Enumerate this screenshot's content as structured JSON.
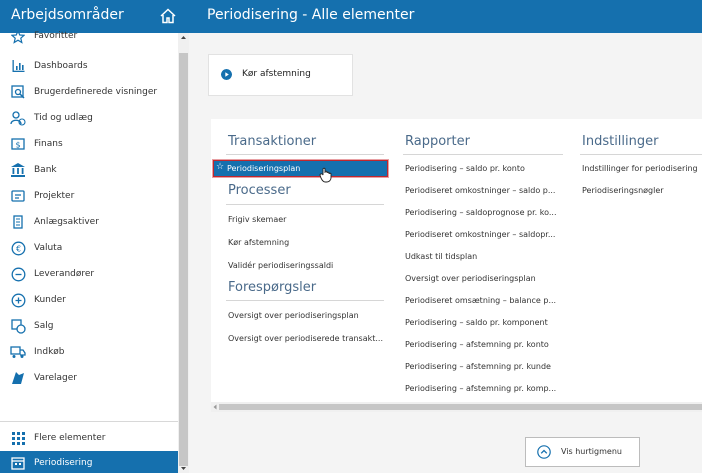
{
  "header": {
    "nav_title": "Arbejdsområder",
    "page_title": "Periodisering - Alle elementer",
    "home_icon": "home-icon"
  },
  "sidebar": {
    "items": [
      {
        "label": "Favoritter",
        "icon": "star-icon"
      },
      {
        "label": "Dashboards",
        "icon": "bar-chart-icon"
      },
      {
        "label": "Brugerdefinerede visninger",
        "icon": "custom-view-icon"
      },
      {
        "label": "Tid og udlæg",
        "icon": "time-expense-icon"
      },
      {
        "label": "Finans",
        "icon": "finance-icon"
      },
      {
        "label": "Bank",
        "icon": "bank-icon"
      },
      {
        "label": "Projekter",
        "icon": "projects-icon"
      },
      {
        "label": "Anlægsaktiver",
        "icon": "fixed-assets-icon"
      },
      {
        "label": "Valuta",
        "icon": "currency-icon"
      },
      {
        "label": "Leverandører",
        "icon": "minus-circle-icon"
      },
      {
        "label": "Kunder",
        "icon": "plus-circle-icon"
      },
      {
        "label": "Salg",
        "icon": "sales-icon"
      },
      {
        "label": "Indkøb",
        "icon": "purchase-icon"
      },
      {
        "label": "Varelager",
        "icon": "inventory-icon"
      },
      {
        "label": "Flere elementer",
        "icon": "grid-dots-icon"
      },
      {
        "label": "Periodisering",
        "icon": "calendar-icon"
      }
    ]
  },
  "tile": {
    "label": "Kør afstemning",
    "icon": "play-icon"
  },
  "sections": {
    "transaktioner": {
      "title": "Transaktioner",
      "items": [
        "Periodiseringsplan"
      ]
    },
    "processer": {
      "title": "Processer",
      "items": [
        "Frigiv skemaer",
        "Kør afstemning",
        "Validér periodiseringssaldi"
      ]
    },
    "forespoergsler": {
      "title": "Forespørgsler",
      "items": [
        "Oversigt over periodiseringsplan",
        "Oversigt over periodiserede transakt..."
      ]
    },
    "rapporter": {
      "title": "Rapporter",
      "items": [
        "Periodisering – saldo pr. konto",
        "Periodiseret omkostninger – saldo p...",
        "Periodisering – saldoprognose pr. ko...",
        "Periodiseret omkostninger – saldopr...",
        "Udkast til tidsplan",
        "Oversigt over periodiseringsplan",
        "Periodiseret omsætning – balance p...",
        "Periodisering – saldo pr. komponent",
        "Periodisering – afstemning pr. konto",
        "Periodisering – afstemning pr. kunde",
        "Periodisering – afstemning pr. komp..."
      ]
    },
    "indstillinger": {
      "title": "Indstillinger",
      "items": [
        "Indstillinger for periodisering",
        "Periodiseringsnøgler"
      ]
    }
  },
  "quick_menu": {
    "label": "Vis hurtigmenu",
    "icon": "chevron-up-circle-icon"
  },
  "colors": {
    "accent": "#1570ae",
    "selection_border": "#c1272d",
    "background": "#f4f4f4"
  }
}
